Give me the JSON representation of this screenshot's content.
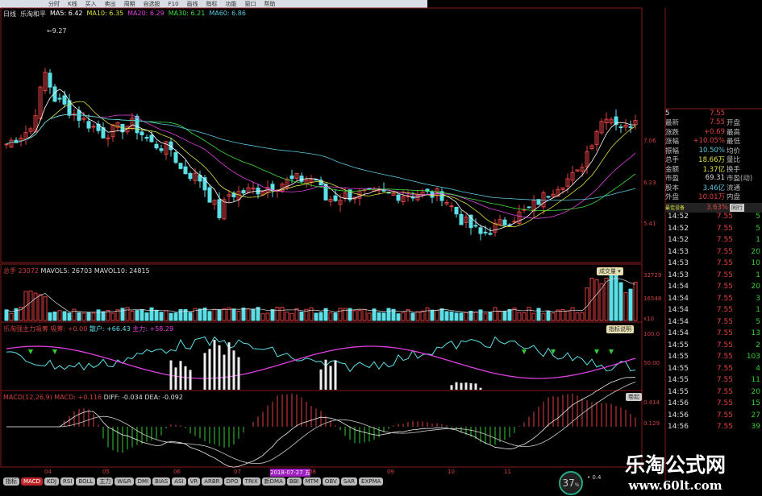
{
  "toolbar": [
    "分时",
    "K线",
    "买入",
    "卖出",
    "周期",
    "自选股",
    "F10",
    "画线",
    "指标",
    "功能",
    "窗口",
    "帮助"
  ],
  "header": {
    "period": "日线",
    "formula": "乐淘和平",
    "ma5": "MA5: 6.42",
    "ma10": "MA10: 6.35",
    "ma20": "MA20: 6.29",
    "ma30": "MA30: 6.21",
    "ma60": "MA60: 6.86",
    "high_mark": "9.27"
  },
  "price_axis": [
    "7.06",
    "6.23",
    "5.41"
  ],
  "volume": {
    "label": "总手",
    "value": "23072",
    "mavol5": "MAVOL5: 26703",
    "mavol10": "MAVOL10: 24815",
    "axis": [
      "32729",
      "16548",
      "x10"
    ],
    "dropdown": "成交量"
  },
  "indicator": {
    "name": "乐淘强主力吸筹",
    "label1": "吸筹: +0.00",
    "label2": "散户: +66.43",
    "label3": "主力: +58.29",
    "axis": [
      "100.0",
      "50.00"
    ],
    "button": "指标说明"
  },
  "macd": {
    "label": "MACD(12,26,9) MACD: +0.116",
    "diff": "DIFF: -0.034",
    "dea": "DEA: -0.092",
    "axis": [
      "0.414",
      "0.129"
    ],
    "button": "卷起"
  },
  "dates": [
    "04",
    "05",
    "06",
    "07",
    "2018-07-27 五",
    "08",
    "09",
    "10",
    "11"
  ],
  "tabs": [
    "指标",
    "MACD",
    "KDJ",
    "RSI",
    "BOLL",
    "主力",
    "W&R",
    "DMI",
    "BIAS",
    "ASI",
    "VR",
    "ARBR",
    "DPO",
    "TRIX",
    "新DMA",
    "BBI",
    "MTM",
    "OBV",
    "SAR",
    "EXPMA"
  ],
  "quote": {
    "top_left": "5",
    "top_right": "7.55",
    "rows": [
      {
        "l": "最新",
        "v": "7.55",
        "r": "开盘",
        "c": "#e04040"
      },
      {
        "l": "涨跌",
        "v": "+0.69",
        "r": "最高",
        "c": "#e04040"
      },
      {
        "l": "涨幅",
        "v": "+10.05%",
        "r": "最低",
        "c": "#e04040"
      },
      {
        "l": "振幅",
        "v": "10.50%",
        "r": "均价",
        "c": "#5cc8e0"
      },
      {
        "l": "总手",
        "v": "18.66万",
        "r": "量比",
        "c": "#e0e040"
      },
      {
        "l": "金额",
        "v": "1.37亿",
        "r": "换手",
        "c": "#e0e040"
      },
      {
        "l": "市盈",
        "v": "69.31",
        "r": "市盈(动)",
        "c": "#ddd"
      },
      {
        "l": "股本",
        "v": "3.46亿",
        "r": "流通",
        "c": "#5cc8e0"
      },
      {
        "l": "外盘",
        "v": "10.01万",
        "r": "内盘",
        "c": "#e04040"
      }
    ],
    "footer_label": "最佳设备",
    "footer_value": "3.63%",
    "footer_btn": "同行"
  },
  "ticks": [
    [
      "14:52",
      "7.55",
      "5"
    ],
    [
      "14:52",
      "7.55",
      "5"
    ],
    [
      "14:52",
      "7.55",
      "1"
    ],
    [
      "14:53",
      "7.55",
      "20"
    ],
    [
      "14:53",
      "7.55",
      "10"
    ],
    [
      "14:53",
      "7.55",
      "1"
    ],
    [
      "14:54",
      "7.55",
      "20"
    ],
    [
      "14:54",
      "7.55",
      "3"
    ],
    [
      "14:54",
      "7.55",
      "1"
    ],
    [
      "14:54",
      "7.55",
      "5"
    ],
    [
      "14:54",
      "7.55",
      "13"
    ],
    [
      "14:55",
      "7.55",
      "2"
    ],
    [
      "14:55",
      "7.55",
      "103"
    ],
    [
      "14:55",
      "7.55",
      "4"
    ],
    [
      "14:55",
      "7.55",
      "11"
    ],
    [
      "14:55",
      "7.55",
      "20"
    ],
    [
      "14:56",
      "7.55",
      "15"
    ],
    [
      "14:56",
      "7.55",
      "27"
    ],
    [
      "14:56",
      "7.55",
      "39"
    ]
  ],
  "status": {
    "cpu": "37",
    "cpu_unit": "%",
    "net": "0.4"
  },
  "watermark": {
    "title": "乐淘公式网",
    "url": "www.60lt.com"
  },
  "colors": {
    "up": "#e04040",
    "down": "#5ce0e8",
    "ma5": "#ffffff",
    "ma10": "#e0e040",
    "ma20": "#e040e0",
    "ma30": "#40e040",
    "ma60": "#5cc8e0"
  },
  "price_waypoints": [
    [
      0,
      7.0
    ],
    [
      5,
      7.3
    ],
    [
      8,
      8.4
    ],
    [
      10,
      7.9
    ],
    [
      14,
      7.6
    ],
    [
      20,
      7.2
    ],
    [
      26,
      7.4
    ],
    [
      30,
      7.0
    ],
    [
      34,
      6.9
    ],
    [
      36,
      6.5
    ],
    [
      40,
      6.3
    ],
    [
      44,
      5.6
    ],
    [
      46,
      6.0
    ],
    [
      52,
      6.1
    ],
    [
      60,
      6.3
    ],
    [
      64,
      6.3
    ],
    [
      66,
      5.9
    ],
    [
      72,
      6.0
    ],
    [
      80,
      6.0
    ],
    [
      90,
      6.0
    ],
    [
      94,
      5.5
    ],
    [
      98,
      5.2
    ],
    [
      100,
      5.3
    ],
    [
      108,
      5.7
    ],
    [
      114,
      6.2
    ],
    [
      118,
      6.4
    ],
    [
      122,
      7.3
    ],
    [
      124,
      7.6
    ],
    [
      128,
      7.3
    ],
    [
      130,
      7.55
    ]
  ]
}
